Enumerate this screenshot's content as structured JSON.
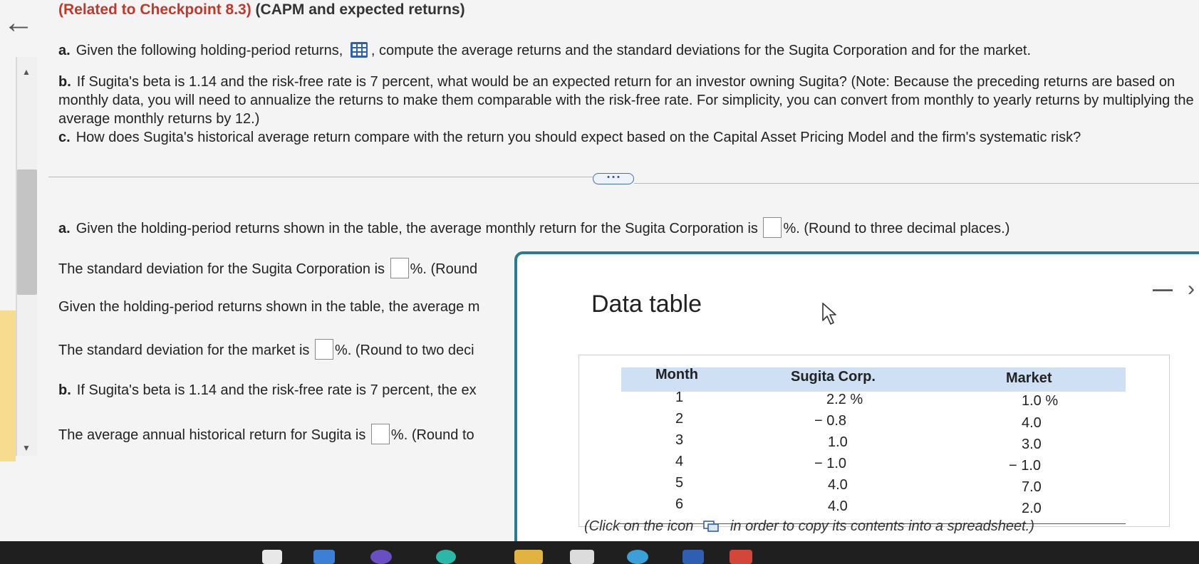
{
  "header": {
    "title_highlight": "(Related to Checkpoint 8.3)",
    "title_rest": "(CAPM and expected returns)"
  },
  "questions": {
    "a_label": "a.",
    "a_text_1": "Given the following holding-period returns,",
    "a_text_2": ", compute the average returns and the standard deviations for the Sugita Corporation and for the market.",
    "b_label": "b.",
    "b_text": "If Sugita's beta is 1.14 and the risk-free rate is 7 percent, what would be an expected return for an investor owning Sugita? (Note: Because the preceding returns are based on monthly data, you will need to annualize the returns to make them comparable with the risk-free rate. For simplicity, you can convert from monthly to yearly returns by multiplying the average monthly returns by 12.)",
    "c_label": "c.",
    "c_text": "How does Sugita's historical average return compare with the return you should expect based on the Capital Asset Pricing Model and the firm's systematic risk?"
  },
  "more_button": "• • •",
  "answers": {
    "a1_label": "a.",
    "a1_pre": "Given the holding-period returns shown in the table, the average monthly return for the Sugita Corporation is",
    "a1_post": "%. (Round to three decimal places.)",
    "a2_pre": "The standard deviation for the Sugita Corporation is",
    "a2_post": "%. (Round",
    "a3_pre": "Given the holding-period returns shown in the table, the average m",
    "a4_pre": "The standard deviation for the market is",
    "a4_post": "%. (Round to two deci",
    "b1_label": "b.",
    "b1_pre": "If Sugita's beta is 1.14 and the risk-free rate is 7 percent, the ex",
    "b2_pre": "The average annual historical return for Sugita is",
    "b2_post": "%. (Round to"
  },
  "popup": {
    "title": "Data table",
    "minimize": "—",
    "columns": [
      "Month",
      "Sugita Corp.",
      "Market"
    ],
    "rows": [
      {
        "month": "1",
        "sugita": "2.2 %",
        "market": "1.0 %"
      },
      {
        "month": "2",
        "sugita": "− 0.8",
        "market": "4.0"
      },
      {
        "month": "3",
        "sugita": "1.0",
        "market": "3.0"
      },
      {
        "month": "4",
        "sugita": "− 1.0",
        "market": "− 1.0"
      },
      {
        "month": "5",
        "sugita": "4.0",
        "market": "7.0"
      },
      {
        "month": "6",
        "sugita": "4.0",
        "market": "2.0"
      }
    ],
    "note_pre": "(Click on the icon",
    "note_post": "in order to copy its contents into a spreadsheet.)"
  },
  "colors": {
    "popup_border": "#2a7b8e",
    "table_header_bg": "#cfe0f5",
    "title_highlight": "#c0392b",
    "taskbar": "#1f1f1f"
  },
  "icons": [
    "back-arrow-icon",
    "data-table-grid-icon",
    "copy-spreadsheet-icon",
    "mouse-cursor-icon",
    "minimize-icon"
  ]
}
